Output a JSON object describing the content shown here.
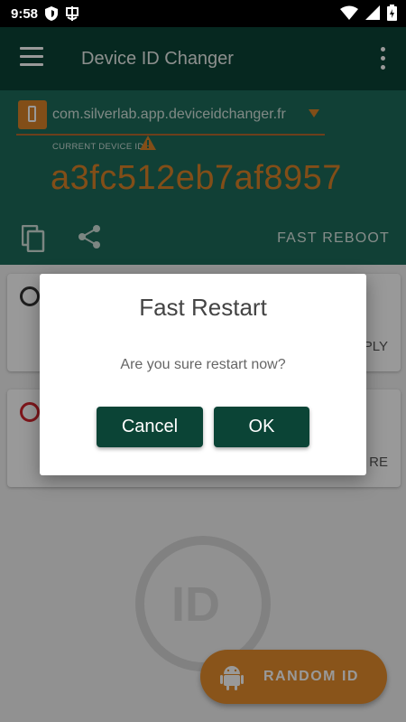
{
  "status_bar": {
    "time": "9:58",
    "left_icons": [
      "shield-icon",
      "notification-app-icon"
    ],
    "right_icons": [
      "wifi-icon",
      "signal-icon",
      "battery-icon"
    ]
  },
  "app_bar": {
    "title": "Device ID Changer",
    "menu_icon": "menu-icon",
    "overflow_icon": "more-vert-icon"
  },
  "header": {
    "package_name": "com.silverlab.app.deviceidchanger.fr",
    "current_device_label": "CURRENT DEVICE ID",
    "device_id": "a3fc512eb7af8957",
    "fast_reboot_label": "FAST REBOOT"
  },
  "cards": [
    {
      "action_label": "PLY"
    },
    {
      "action_label": "RE"
    }
  ],
  "fab": {
    "label": "RANDOM ID",
    "icon": "android-icon"
  },
  "dialog": {
    "title": "Fast Restart",
    "message": "Are you sure restart now?",
    "cancel_label": "Cancel",
    "ok_label": "OK"
  },
  "colors": {
    "app_bar": "#0b4436",
    "header_panel": "#1d6b5a",
    "accent_orange": "#d98228",
    "dialog_button": "#0b4436"
  }
}
